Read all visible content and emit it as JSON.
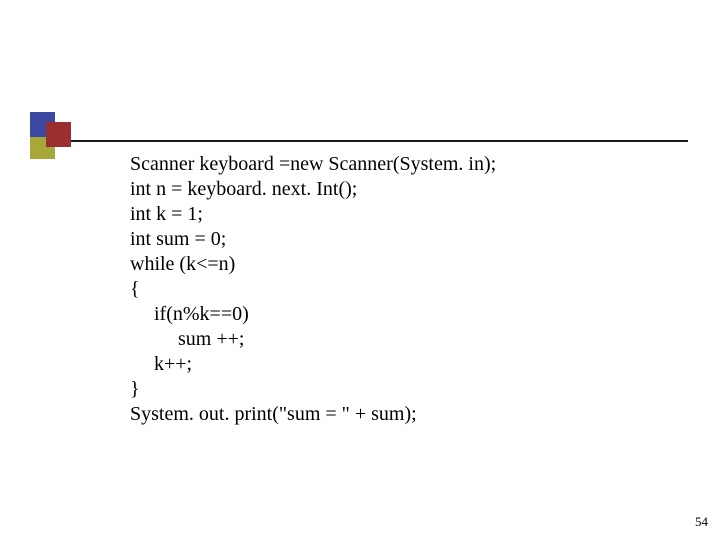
{
  "decoration": {
    "squares": [
      "blue",
      "red",
      "olive"
    ]
  },
  "code": {
    "lines": [
      {
        "text": "Scanner keyboard =new Scanner(System. in);",
        "indent": 0
      },
      {
        "text": "int n = keyboard. next. Int();",
        "indent": 0
      },
      {
        "text": "int k = 1;",
        "indent": 0
      },
      {
        "text": "int sum = 0;",
        "indent": 0
      },
      {
        "text": "while (k<=n)",
        "indent": 0
      },
      {
        "text": "{",
        "indent": 0
      },
      {
        "text": "if(n%k==0)",
        "indent": 1
      },
      {
        "text": "sum ++;",
        "indent": 2
      },
      {
        "text": "k++;",
        "indent": 1
      },
      {
        "text": "}",
        "indent": 0
      },
      {
        "text": "System. out. print(\"sum = \" + sum);",
        "indent": 0
      }
    ]
  },
  "page_number": "54"
}
